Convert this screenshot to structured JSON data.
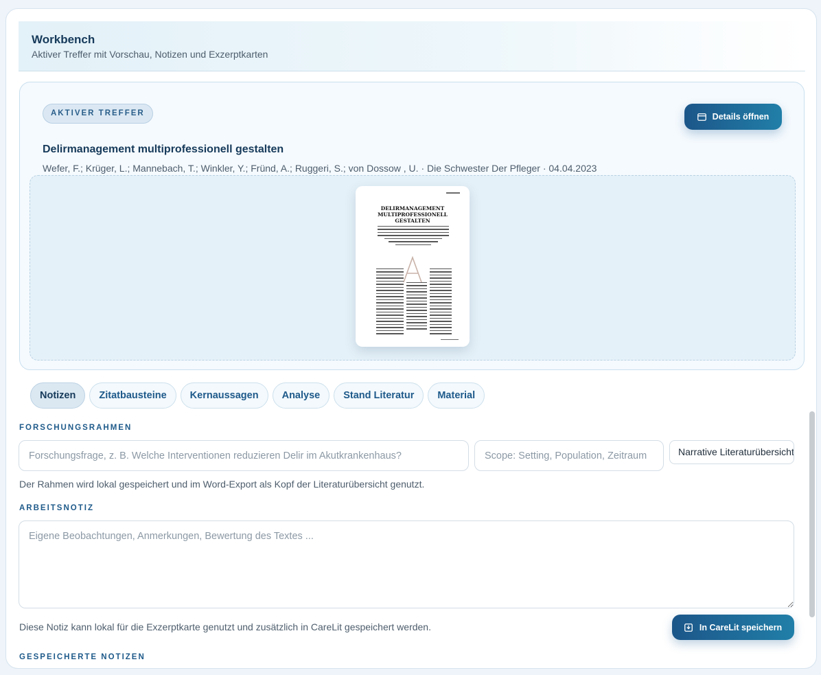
{
  "header": {
    "title": "Workbench",
    "subtitle": "Aktiver Treffer mit Vorschau, Notizen und Exzerptkarten"
  },
  "active_hit": {
    "badge": "AKTIVER TREFFER",
    "details_button": "Details öffnen",
    "title": "Delirmanagement multiprofessionell gestalten",
    "meta": "Wefer, F.; Krüger, L.; Mannebach, T.; Winkler, Y.; Fründ, A.; Ruggeri, S.; von Dossow , U. · Die Schwester Der Pfleger · 04.04.2023",
    "preview_heading": [
      "DELIRMANAGEMENT",
      "MULTIPROFESSIONELL",
      "GESTALTEN"
    ]
  },
  "tabs": [
    {
      "label": "Notizen",
      "active": true
    },
    {
      "label": "Zitatbausteine",
      "active": false
    },
    {
      "label": "Kernaussagen",
      "active": false
    },
    {
      "label": "Analyse",
      "active": false
    },
    {
      "label": "Stand Literatur",
      "active": false
    },
    {
      "label": "Material",
      "active": false
    }
  ],
  "research_frame": {
    "label": "FORSCHUNGSRAHMEN",
    "question_placeholder": "Forschungsfrage, z. B. Welche Interventionen reduzieren Delir im Akutkrankenhaus?",
    "scope_placeholder": "Scope: Setting, Population, Zeitraum",
    "review_type": "Narrative Literaturübersicht",
    "helper": "Der Rahmen wird lokal gespeichert und im Word-Export als Kopf der Literaturübersicht genutzt."
  },
  "work_note": {
    "label": "ARBEITSNOTIZ",
    "placeholder": "Eigene Beobachtungen, Anmerkungen, Bewertung des Textes ...",
    "helper": "Diese Notiz kann lokal für die Exzerptkarte genutzt und zusätzlich in CareLit gespeichert werden.",
    "save_button": "In CareLit speichern"
  },
  "saved_notes": {
    "label": "GESPEICHERTE NOTIZEN"
  },
  "colors": {
    "accent": "#1e5a8a",
    "button_gradient_start": "#1c5689",
    "button_gradient_end": "#217fa8"
  }
}
